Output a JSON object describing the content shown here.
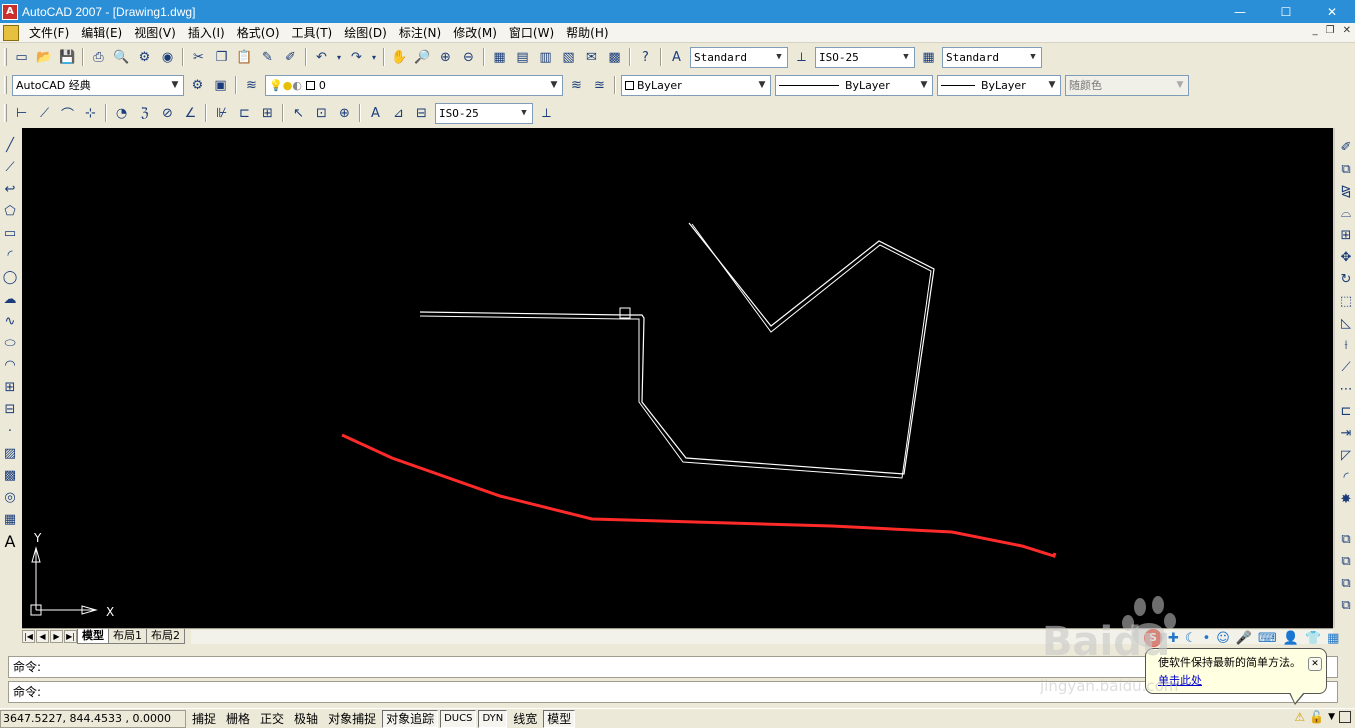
{
  "window": {
    "title": "AutoCAD 2007 - [Drawing1.dwg]",
    "controls": {
      "minimize": "—",
      "maximize": "☐",
      "close": "✕"
    }
  },
  "menu": {
    "items": [
      "文件(F)",
      "编辑(E)",
      "视图(V)",
      "插入(I)",
      "格式(O)",
      "工具(T)",
      "绘图(D)",
      "标注(N)",
      "修改(M)",
      "窗口(W)",
      "帮助(H)"
    ],
    "mdi": {
      "minimize": "_",
      "restore": "❐",
      "close": "✕"
    }
  },
  "toolbar1": {
    "text_style": "Standard",
    "dim_style": "ISO-25",
    "table_style": "Standard"
  },
  "toolbar2": {
    "workspace": "AutoCAD 经典",
    "layer": "0",
    "color": "ByLayer",
    "linetype": "ByLayer",
    "lineweight": "ByLayer",
    "plot_style": "随颜色"
  },
  "toolbar3": {
    "dim_style": "ISO-25"
  },
  "ucs": {
    "x_label": "X",
    "y_label": "Y"
  },
  "layout_tabs": {
    "tabs": [
      "模型",
      "布局1",
      "布局2"
    ],
    "active": "模型"
  },
  "command": {
    "line1_prompt": "命令:",
    "line2_prompt": "命令:"
  },
  "status": {
    "coords": "3647.5227, 844.4533 , 0.0000",
    "buttons": [
      {
        "label": "捕捉",
        "on": false
      },
      {
        "label": "栅格",
        "on": false
      },
      {
        "label": "正交",
        "on": false
      },
      {
        "label": "极轴",
        "on": false
      },
      {
        "label": "对象捕捉",
        "on": false
      },
      {
        "label": "对象追踪",
        "on": true
      },
      {
        "label": "DUCS",
        "on": true
      },
      {
        "label": "DYN",
        "on": true
      },
      {
        "label": "线宽",
        "on": false
      },
      {
        "label": "模型",
        "on": true
      }
    ]
  },
  "balloon": {
    "message": "使软件保持最新的简单方法。",
    "link": "单击此处"
  },
  "watermark": {
    "text": "Baidu",
    "subtext": "jingyan.baidu.com"
  },
  "colors": {
    "titlebar": "#2b8fd8",
    "canvas": "#000000",
    "red_polyline": "#ff2a2a",
    "white_polyline": "#ffffff"
  }
}
